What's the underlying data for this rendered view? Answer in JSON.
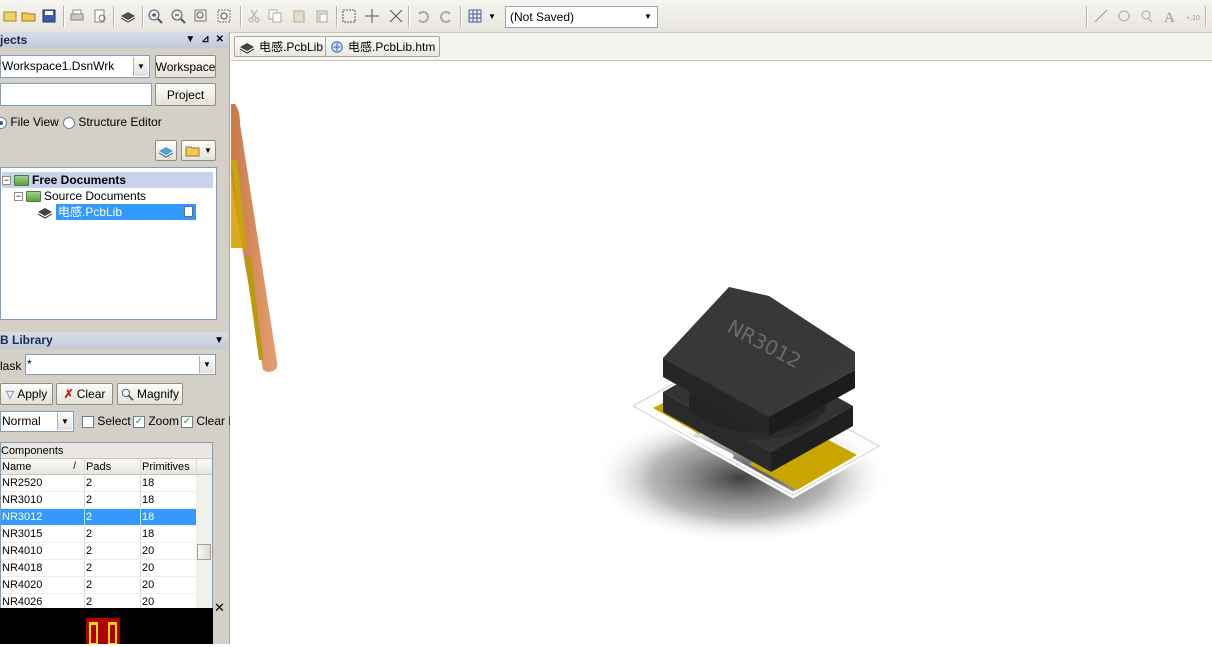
{
  "toolbar": {
    "icons": [
      "open-folder-icon",
      "open-icon",
      "save-icon",
      "print-icon",
      "print-preview-icon",
      "layers-3d-icon",
      "zoom-in-icon",
      "zoom-out-icon",
      "zoom-fit-icon",
      "zoom-area-icon",
      "cut-icon",
      "copy-icon",
      "paste-icon",
      "paste-special-icon",
      "select-rect-icon",
      "move-icon",
      "cross-icon",
      "undo-icon",
      "redo-icon",
      "grid-icon",
      "line-icon",
      "circle-icon",
      "pin-icon",
      "text-icon",
      "string-icon"
    ],
    "selector_value": "(Not Saved)"
  },
  "projects_panel": {
    "title": "jects",
    "workspace_value": "Workspace1.DsnWrk",
    "workspace_button": "Workspace",
    "project_value": "",
    "project_button": "Project",
    "file_view_label": "File View",
    "structure_editor_label": "Structure Editor",
    "tree": {
      "root": "Free Documents",
      "group": "Source Documents",
      "file": "电感.PcbLib"
    }
  },
  "library_panel": {
    "title": "B Library",
    "mask_label": "lask",
    "mask_value": "*",
    "apply_label": "Apply",
    "clear_label": "Clear",
    "magnify_label": "Magnify",
    "mode_value": "Normal",
    "select_label": "Select",
    "zoom_label": "Zoom",
    "clear_existing_label": "Clear E",
    "grid_title": "Components",
    "columns": [
      "Name",
      "Pads",
      "Primitives"
    ],
    "sort_marker": "/",
    "rows": [
      {
        "name": "NR2520",
        "pads": "2",
        "primitives": "18"
      },
      {
        "name": "NR3010",
        "pads": "2",
        "primitives": "18"
      },
      {
        "name": "NR3012",
        "pads": "2",
        "primitives": "18"
      },
      {
        "name": "NR3015",
        "pads": "2",
        "primitives": "18"
      },
      {
        "name": "NR4010",
        "pads": "2",
        "primitives": "20"
      },
      {
        "name": "NR4018",
        "pads": "2",
        "primitives": "20"
      },
      {
        "name": "NR4020",
        "pads": "2",
        "primitives": "20"
      },
      {
        "name": "NR4026",
        "pads": "2",
        "primitives": "20"
      }
    ],
    "selected_index": 2
  },
  "doc_tabs": [
    {
      "label": "电感.PcbLib"
    },
    {
      "label": "电感.PcbLib.htm"
    }
  ],
  "canvas": {
    "component_marking": "NR3012"
  }
}
